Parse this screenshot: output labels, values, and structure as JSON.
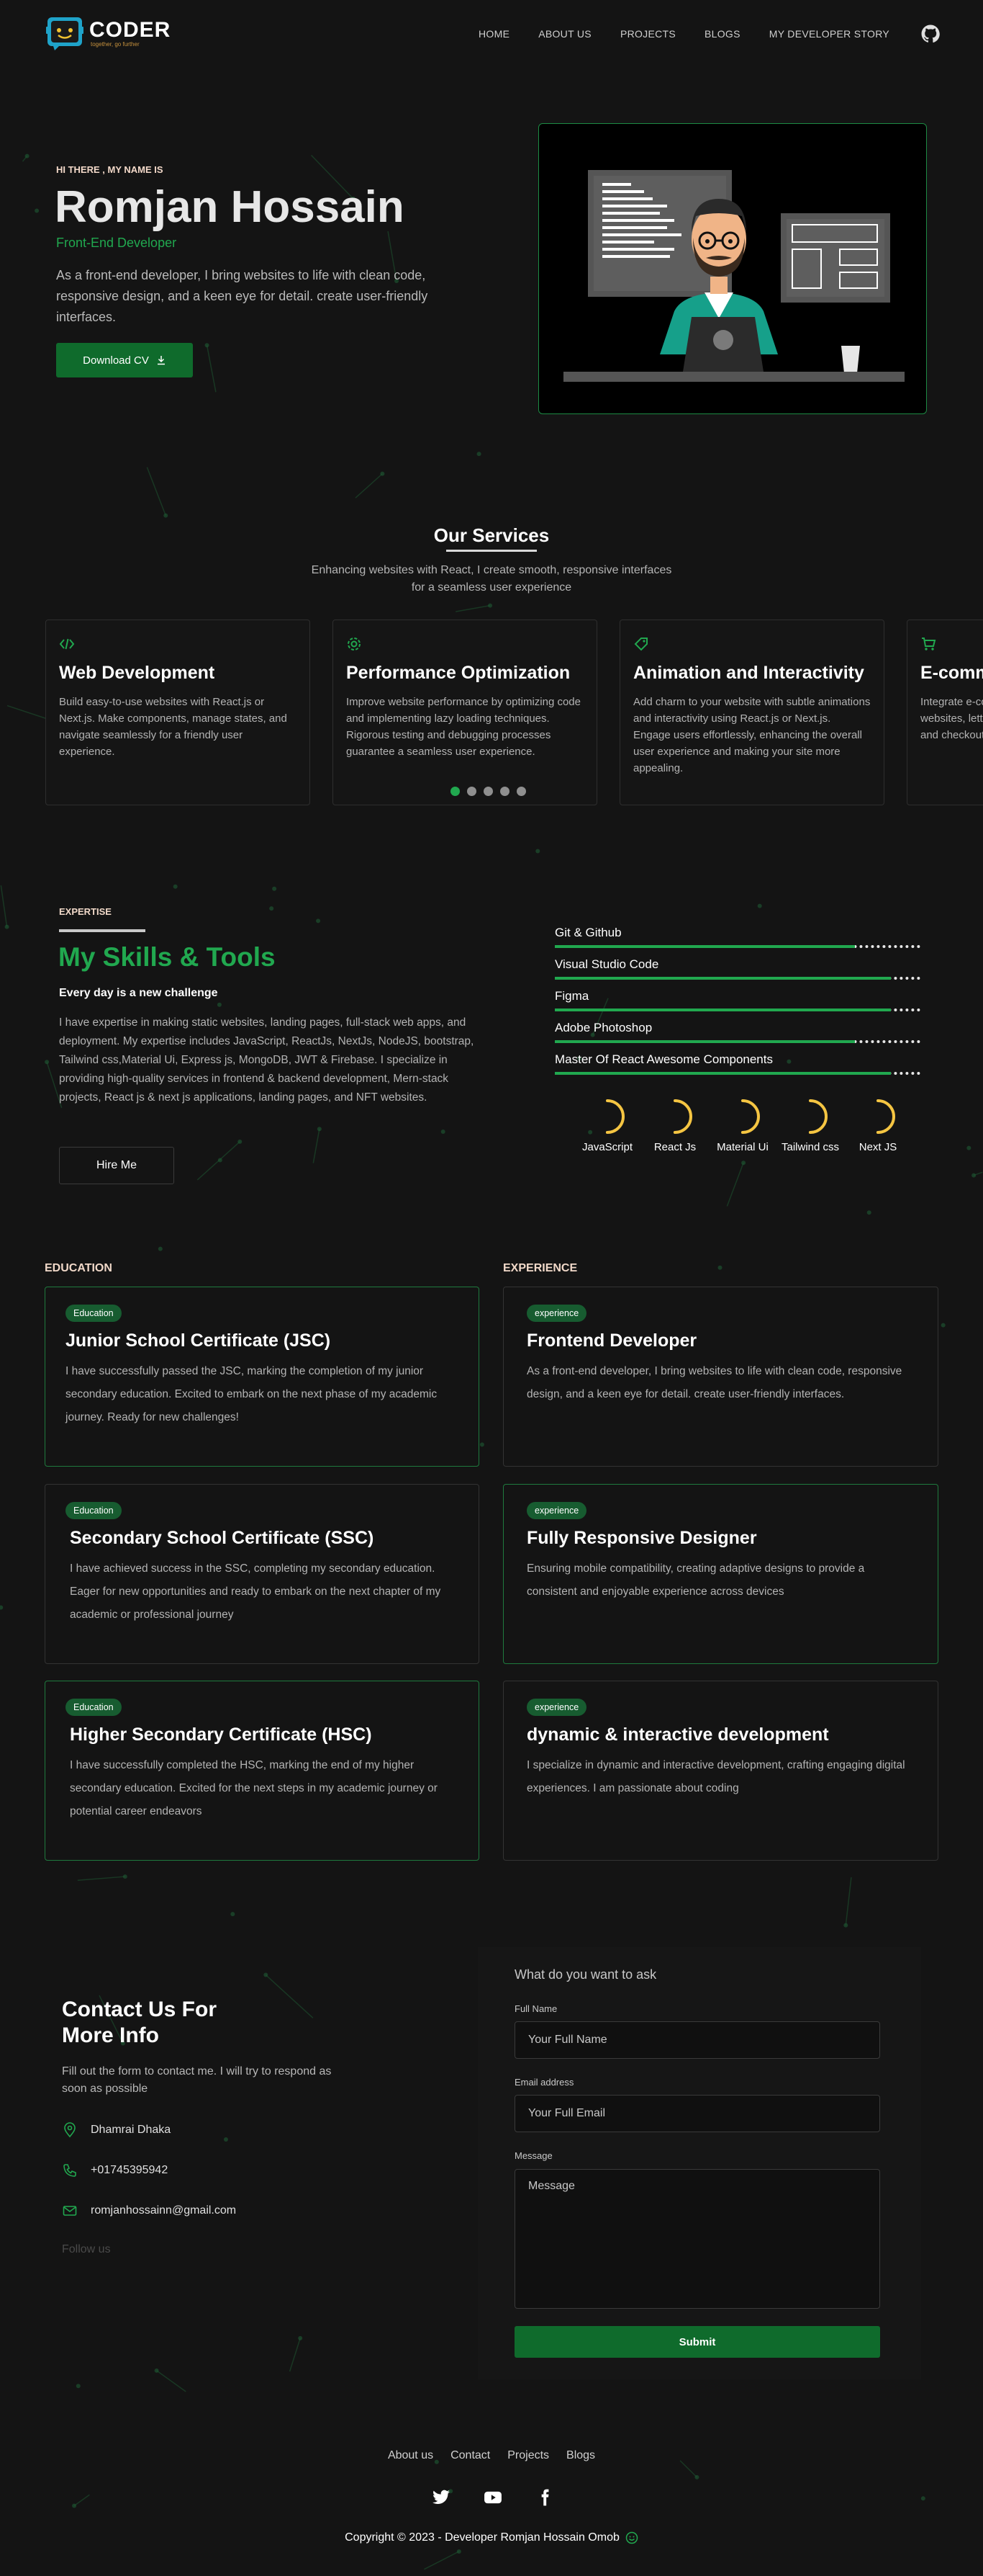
{
  "nav": {
    "logo_name": "CODER",
    "logo_tagline": "together, go further",
    "links": [
      "HOME",
      "ABOUT US",
      "PROJECTS",
      "BLOGS",
      "MY DEVELOPER STORY"
    ],
    "github_icon": "github-icon"
  },
  "hero": {
    "greeting": "HI THERE , MY NAME IS",
    "name": "Romjan Hossain",
    "role": "Front-End Developer",
    "description": "As a front-end developer, I bring websites to life with clean code, responsive design, and a keen eye for detail. create user-friendly interfaces.",
    "cv_button": "Download CV"
  },
  "services": {
    "title": "Our Services",
    "subtitle": "Enhancing websites with React, I create smooth, responsive interfaces for a seamless user experience",
    "cards": [
      {
        "icon": "code-icon",
        "title": "Web Development",
        "desc": "Build easy-to-use websites with React.js or Next.js. Make components, manage states, and navigate seamlessly for a friendly user experience."
      },
      {
        "icon": "gear-icon",
        "title": "Performance Optimization",
        "desc": "Improve website performance by optimizing code and implementing lazy loading techniques. Rigorous testing and debugging processes guarantee a seamless user experience."
      },
      {
        "icon": "tag-icon",
        "title": "Animation and Interactivity",
        "desc": "Add charm to your website with subtle animations and interactivity using React.js or Next.js. Engage users effortlessly, enhancing the overall user experience and making your site more appealing."
      },
      {
        "icon": "cart-icon",
        "title": "E-commerce Solutions",
        "desc": "Integrate e-commerce features into existing websites, letting customers browse, add to cart and checkout easily."
      }
    ],
    "carousel_pages": 5,
    "active_page": 0
  },
  "skills": {
    "tag": "EXPERTISE",
    "title": "My Skills & Tools",
    "subtitle": "Every day is a new challenge",
    "description": "I have expertise in making static websites, landing pages, full-stack web apps, and deployment. My expertise includes JavaScript, ReactJs, NextJs, NodeJS, bootstrap, Tailwind css,Material Ui, Express js, MongoDB, JWT & Firebase. I specialize in providing high-quality services in frontend & backend development, Mern-stack projects, React js & next js applications, landing pages, and NFT websites.",
    "hire_button": "Hire Me",
    "bars": [
      {
        "label": "Git & Github",
        "level": 0.82
      },
      {
        "label": "Visual Studio Code",
        "level": 0.92
      },
      {
        "label": "Figma",
        "level": 0.92
      },
      {
        "label": "Adobe Photoshop",
        "level": 0.82
      },
      {
        "label": "Master Of React Awesome Components",
        "level": 0.92
      }
    ],
    "circles": [
      {
        "label": "JavaScript",
        "level": 0.5
      },
      {
        "label": "React Js",
        "level": 0.5
      },
      {
        "label": "Material Ui",
        "level": 0.5
      },
      {
        "label": "Tailwind css",
        "level": 0.5
      },
      {
        "label": "Next JS",
        "level": 0.5
      }
    ]
  },
  "timeline": {
    "education_head": "EDUCATION",
    "experience_head": "EXPERIENCE",
    "education": [
      {
        "badge": "Education",
        "title": "Junior School Certificate (JSC)",
        "desc": "I have successfully passed the JSC, marking the completion of my junior secondary education. Excited to embark on the next phase of my academic journey. Ready for new challenges!"
      },
      {
        "badge": "Education",
        "title": "Secondary School Certificate (SSC)",
        "desc": "I have achieved success in the SSC, completing my secondary education. Eager for new opportunities and ready to embark on the next chapter of my academic or professional journey"
      },
      {
        "badge": "Education",
        "title": "Higher Secondary Certificate (HSC)",
        "desc": "I have successfully completed the HSC, marking the end of my higher secondary education. Excited for the next steps in my academic journey or potential career endeavors"
      }
    ],
    "experience": [
      {
        "badge": "experience",
        "title": "Frontend Developer",
        "desc": "As a front-end developer, I bring websites to life with clean code, responsive design, and a keen eye for detail. create user-friendly interfaces."
      },
      {
        "badge": "experience",
        "title": "Fully Responsive Designer",
        "desc": "Ensuring mobile compatibility, creating adaptive designs to provide a consistent and enjoyable experience across devices"
      },
      {
        "badge": "experience",
        "title": "dynamic & interactive development",
        "desc": "I specialize in dynamic and interactive development, crafting engaging digital experiences. I am passionate about coding"
      }
    ]
  },
  "contact": {
    "heading": "Contact Us For More Info",
    "subtitle": "Fill out the form to contact me. I will try to respond as soon as possible",
    "location": "Dhamrai Dhaka",
    "phone": "+01745395942",
    "email": "romjanhossainn@gmail.com",
    "follow": "Follow us",
    "form": {
      "title": "What do you want to ask",
      "name_label": "Full Name",
      "name_placeholder": "Your Full Name",
      "email_label": "Email address",
      "email_placeholder": "Your Full Email",
      "message_label": "Message",
      "message_placeholder": "Message",
      "submit": "Submit"
    }
  },
  "footer": {
    "links": [
      "About us",
      "Contact",
      "Projects",
      "Blogs"
    ],
    "social": [
      "twitter-icon",
      "youtube-icon",
      "facebook-icon"
    ],
    "copyright": "Copyright © 2023 - Developer Romjan Hossain Omob"
  },
  "colors": {
    "background": "#141414",
    "accent_green": "#21a84f",
    "button_green": "#0f6b2c",
    "progress_yellow": "#f5c542"
  }
}
